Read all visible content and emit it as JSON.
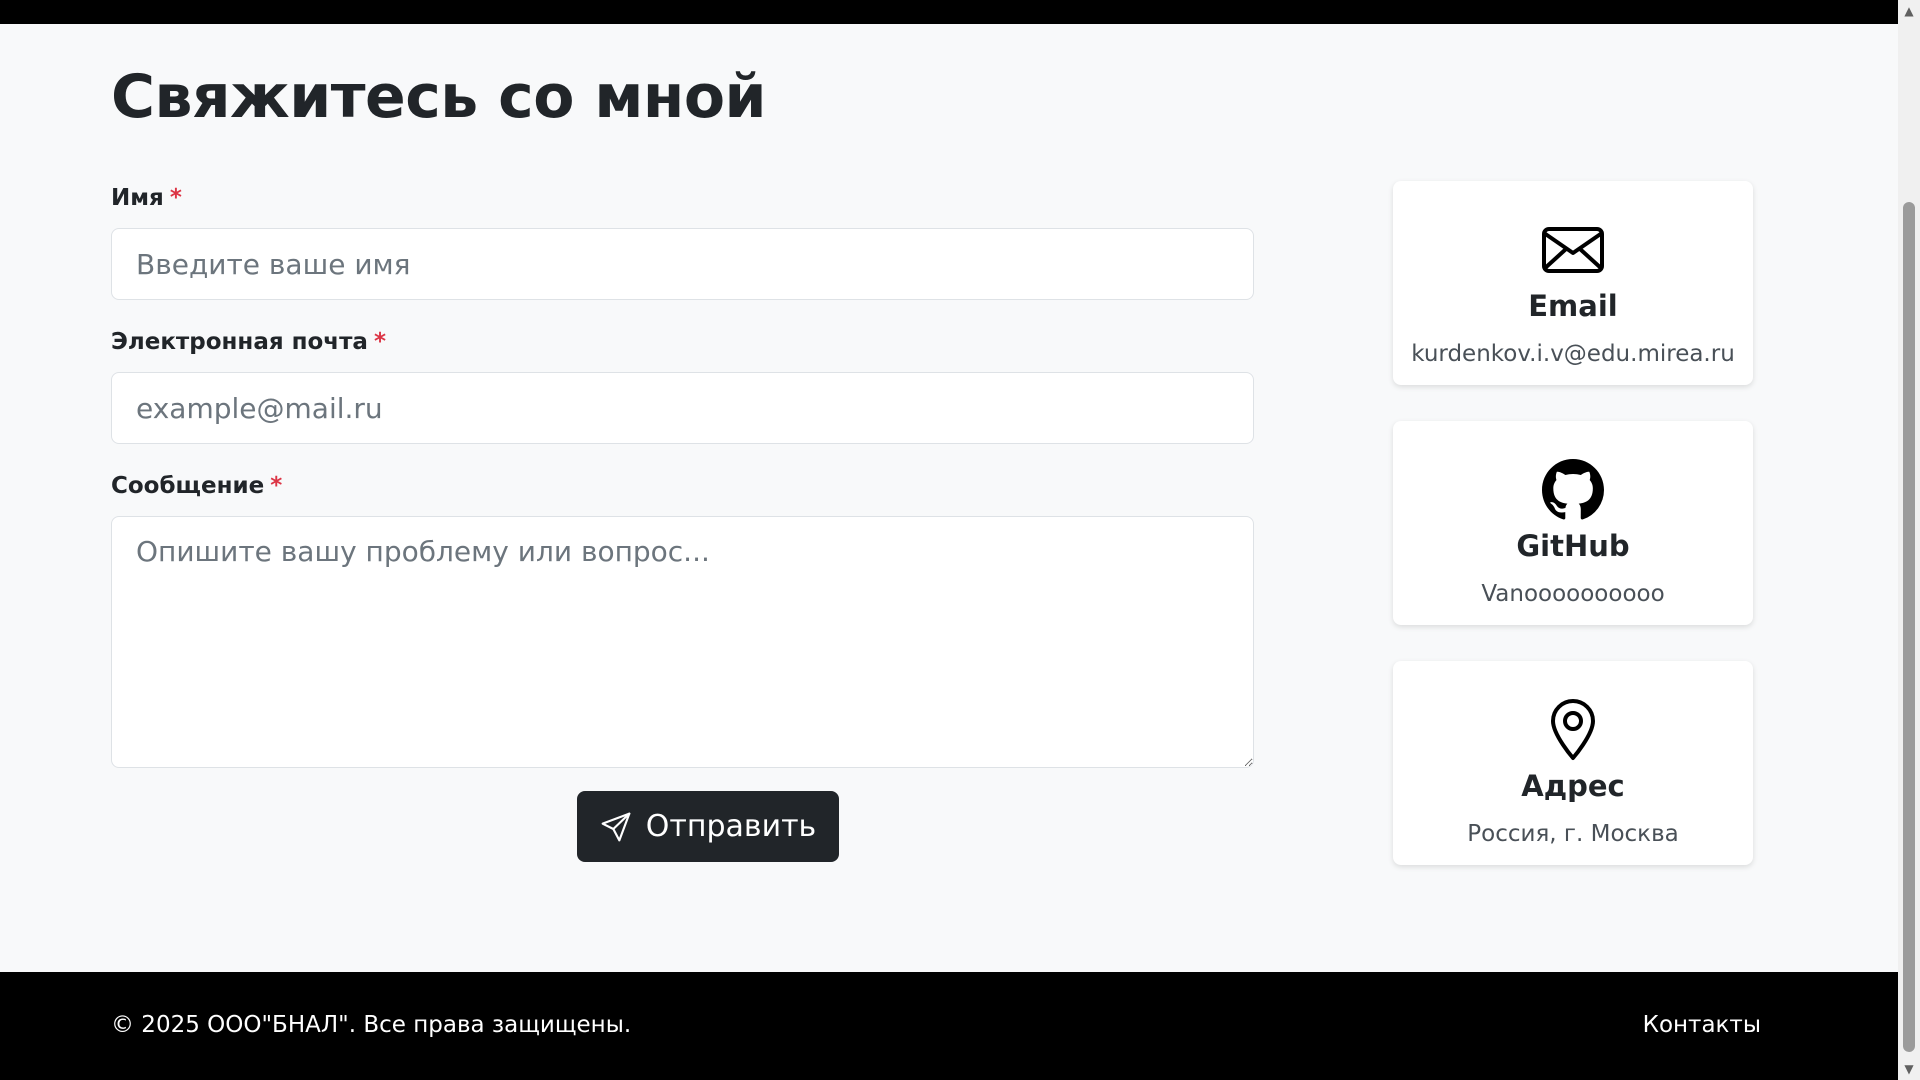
{
  "page": {
    "title": "Свяжитесь со мной"
  },
  "form": {
    "name_label": "Имя",
    "name_placeholder": "Введите ваше имя",
    "email_label": "Электронная почта",
    "email_placeholder": "example@mail.ru",
    "message_label": "Сообщение",
    "message_placeholder": "Опишите вашу проблему или вопрос...",
    "required_mark": "*",
    "submit_label": "Отправить",
    "submit_icon": "send-icon"
  },
  "contacts": [
    {
      "icon": "envelope-icon",
      "title": "Email",
      "value": "kurdenkov.i.v@edu.mirea.ru"
    },
    {
      "icon": "github-icon",
      "title": "GitHub",
      "value": "Vanoooooooooo"
    },
    {
      "icon": "map-pin-icon",
      "title": "Адрес",
      "value": "Россия, г. Москва"
    }
  ],
  "footer": {
    "copyright": "© 2025 ООО\"БНАЛ\". Все права защищены.",
    "contacts_link": "Контакты"
  },
  "colors": {
    "background": "#f8f9fa",
    "primary_dark": "#212529",
    "required": "#dc3545",
    "footer_bg": "#000000"
  }
}
